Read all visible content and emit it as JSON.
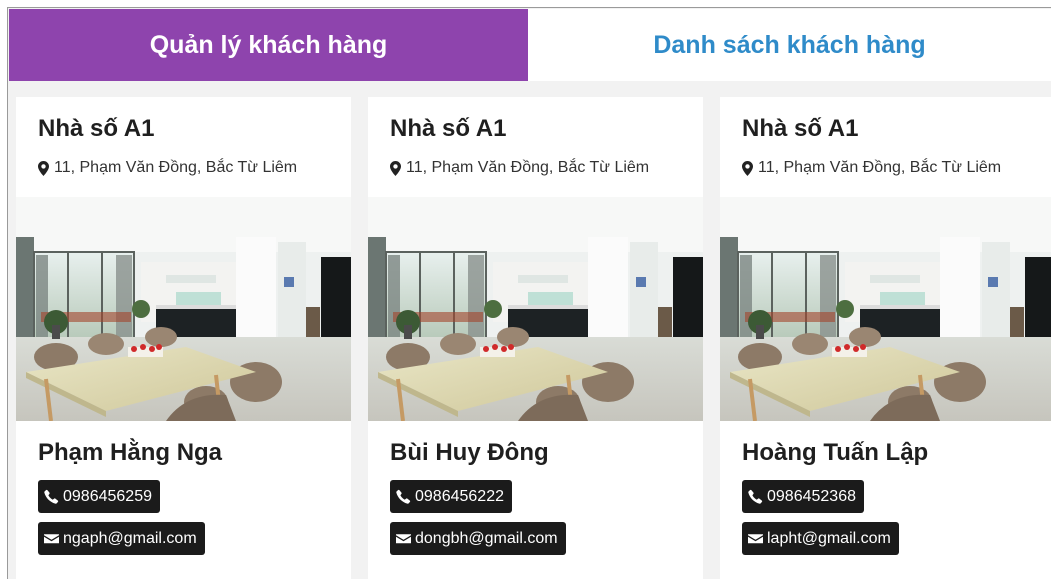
{
  "tabs": [
    {
      "label": "Quản lý khách hàng",
      "active": true
    },
    {
      "label": "Danh sách khách hàng",
      "active": false
    }
  ],
  "colors": {
    "active_tab": "#8e44ad",
    "inactive_tab_text": "#2f8bc9",
    "badge_bg": "#1b1b1b",
    "page_bg": "#f2f2f2"
  },
  "cards": [
    {
      "title": "Nhà số A1",
      "address": "11, Phạm Văn Đồng, Bắc Từ Liêm",
      "address_icon": "map-marker-icon",
      "name": "Phạm Hằng Nga",
      "phone": "0986456259",
      "phone_icon": "phone-icon",
      "email": "ngaph@gmail.com",
      "email_icon": "envelope-icon"
    },
    {
      "title": "Nhà số A1",
      "address": "11, Phạm Văn Đồng, Bắc Từ Liêm",
      "address_icon": "map-marker-icon",
      "name": "Bùi Huy Đông",
      "phone": "0986456222",
      "phone_icon": "phone-icon",
      "email": "dongbh@gmail.com",
      "email_icon": "envelope-icon"
    },
    {
      "title": "Nhà số A1",
      "address": "11, Phạm Văn Đồng, Bắc Từ Liêm",
      "address_icon": "map-marker-icon",
      "name": "Hoàng Tuấn Lập",
      "phone": "0986452368",
      "phone_icon": "phone-icon",
      "email": "lapht@gmail.com",
      "email_icon": "envelope-icon"
    }
  ]
}
